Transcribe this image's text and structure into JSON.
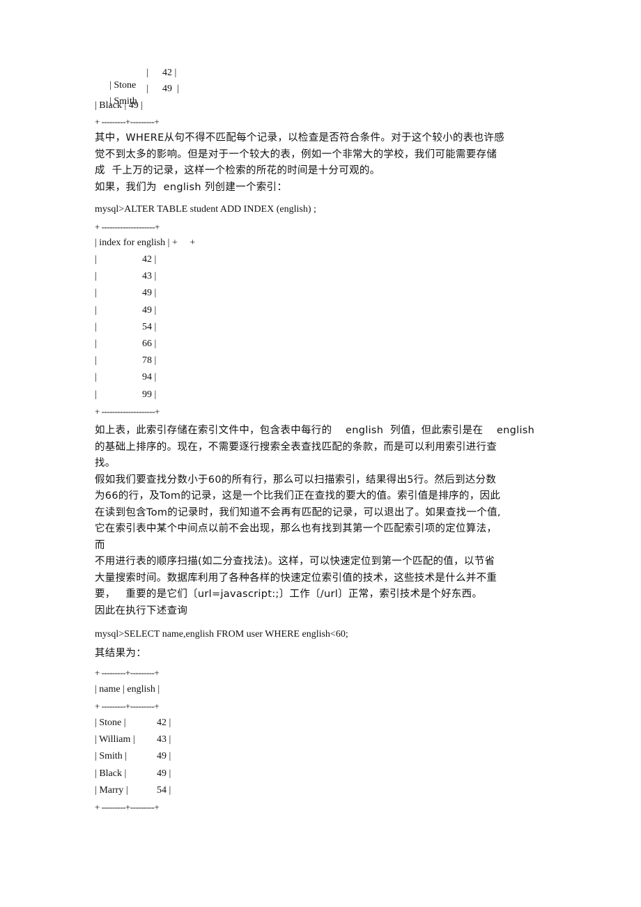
{
  "table1_tail": {
    "rows": [
      {
        "name": "Stone",
        "english": "42"
      },
      {
        "name": "Smith",
        "english": "49"
      },
      {
        "raw": "| Black | 49 |"
      }
    ],
    "border": "+ ---------+---------+"
  },
  "para1": {
    "lines": [
      "其中，WHERE从句不得不匹配每个记录，以检查是否符合条件。对于这个较小的表也许感",
      "觉不到太多的影响。但是对于一个较大的表，例如一个非常大的学校，我们可能需要存储",
      "成  千上万的记录，这样一个检索的所花的时间是十分可观的。",
      "如果，我们为  english 列创建一个索引："
    ]
  },
  "sql1": "mysql>ALTER TABLE student ADD INDEX (english) ;",
  "index_table": {
    "border_top": "+ --------------------+",
    "header": "| index for english | +     +",
    "values": [
      "42",
      "43",
      "49",
      "49",
      "54",
      "66",
      "78",
      "94",
      "99"
    ],
    "border_bottom": "+ --------------------+"
  },
  "para2": {
    "lines": [
      "如上表，此索引存储在索引文件中，包含表中每行的    english  列值，但此索引是在    english",
      "的基础上排序的。现在，不需要逐行搜索全表查找匹配的条款，而是可以利用索引进行查",
      "找。",
      "假如我们要查找分数小于60的所有行，那么可以扫描索引，结果得出5行。然后到达分数",
      "为66的行，及Tom的记录，这是一个比我们正在查找的要大的值。索引值是排序的，因此",
      "在读到包含Tom的记录时，我们知道不会再有匹配的记录，可以退出了。如果查找一个值,",
      "它在索引表中某个中间点以前不会出现，那么也有找到其第一个匹配索引项的定位算法，",
      "而",
      "不用进行表的顺序扫描(如二分查找法)。这样，可以快速定位到第一个匹配的值，以节省",
      "大量搜索时间。数据库利用了各种各样的快速定位索引值的技术，这些技术是什么并不重",
      "要，   重要的是它们〔url=javascript:;〕工作〔/url〕正常，索引技术是个好东西。",
      "因此在执行下述查询"
    ]
  },
  "sql2": "mysql>SELECT name,english FROM user WHERE english<60;",
  "result_label": "其结果为：",
  "result_table": {
    "border": "+ ---------+---------+",
    "header": "| name | english |",
    "rows": [
      {
        "name": "Stone",
        "english": "42"
      },
      {
        "name": "William",
        "english": "43"
      },
      {
        "name": "Smith",
        "english": "49"
      },
      {
        "name": "Black",
        "english": "49"
      },
      {
        "name": "Marry",
        "english": "54"
      }
    ]
  }
}
